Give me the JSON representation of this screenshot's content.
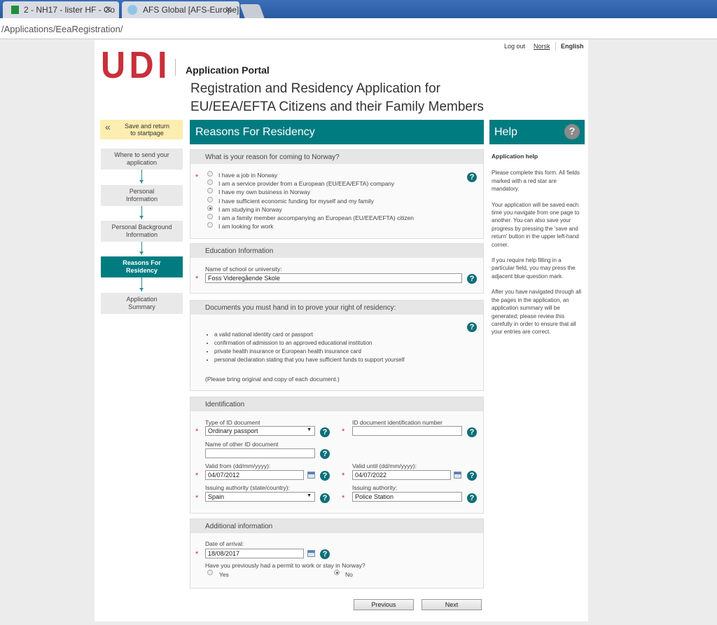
{
  "browser": {
    "tabs": [
      "2 - NH17 - lister HF - Go",
      "AFS Global [AFS-Europe]"
    ],
    "url": "/Applications/EeaRegistration/"
  },
  "header": {
    "logo": "UDI",
    "portal": "Application Portal",
    "title_line1": "Registration and Residency Application for",
    "title_line2": "EU/EEA/EFTA Citizens and their Family Members",
    "logout": "Log out",
    "norsk": "Norsk",
    "english": "English"
  },
  "nav": {
    "save_line1": "Save and return",
    "save_line2": "to startpage",
    "steps": [
      [
        "Where to send your",
        "application"
      ],
      [
        "Personal",
        "Information"
      ],
      [
        "Personal Background",
        "Information"
      ],
      [
        "Reasons For",
        "Residency"
      ],
      [
        "Application",
        "Summary"
      ]
    ],
    "active_step": 3
  },
  "main": {
    "title": "Reasons For Residency",
    "reason": {
      "heading": "What is your reason for coming to Norway?",
      "options": [
        "I have a job in Norway",
        "I am a service provider from a European (EU/EEA/EFTA) company",
        "I have my own business in Norway",
        "I have sufficient economic funding for myself and my family",
        "I am studying in Norway",
        "I am a family member accompanying an European (EU/EEA/EFTA) citizen",
        "I am looking for work"
      ],
      "selected": "I am studying in Norway"
    },
    "education": {
      "heading": "Education Information",
      "school_label": "Name of school or university:",
      "school_value": "Foss Videregående Skole"
    },
    "documents": {
      "heading": "Documents you must hand in to prove your right of residency:",
      "items": [
        "a valid national identity card or passport",
        "confirmation of admission to an approved educational institution",
        "private health insurance or European health insurance card",
        "personal declaration stating that you have sufficient funds to support yourself"
      ],
      "note": "(Please bring original and copy of each document.)"
    },
    "identification": {
      "heading": "Identification",
      "type_label": "Type of ID document",
      "type_value": "Ordinary passport",
      "idnum_label": "ID document identification number",
      "idnum_value": "",
      "other_label": "Name of other ID document",
      "other_value": "",
      "from_label": "Valid from (dd/mm/yyyy):",
      "from_value": "04/07/2012",
      "until_label": "Valid until (dd/mm/yyyy):",
      "until_value": "04/07/2022",
      "auth_country_label": "Issuing authority (state/country):",
      "auth_country_value": "Spain",
      "auth_label": "Issuing authority:",
      "auth_value": "Police Station"
    },
    "additional": {
      "heading": "Additional information",
      "arrival_label": "Date of arrival:",
      "arrival_value": "18/08/2017",
      "permit_question": "Have you previously had a permit to work or stay in Norway?",
      "yes": "Yes",
      "no": "No",
      "selected": "No"
    },
    "previous": "Previous",
    "next": "Next"
  },
  "help": {
    "title": "Help",
    "heading": "Application help",
    "paragraphs": [
      "Please complete this form. All fields marked with a red star are mandatory.",
      "Your application will be saved each time you navigate from one page to another. You can also save your progress by pressing the 'save and return' button in the upper left-hand corner.",
      "If you require help filling in a particular field, you may press the adjacent blue question mark.",
      "After you have navigated through all the pages in the application, an application summary will be generated; please review this carefully in order to ensure that all your entries are correct."
    ]
  },
  "colors": {
    "teal": "#007c80",
    "udi_red": "#c8303a",
    "save_yellow": "#fcedb0"
  }
}
